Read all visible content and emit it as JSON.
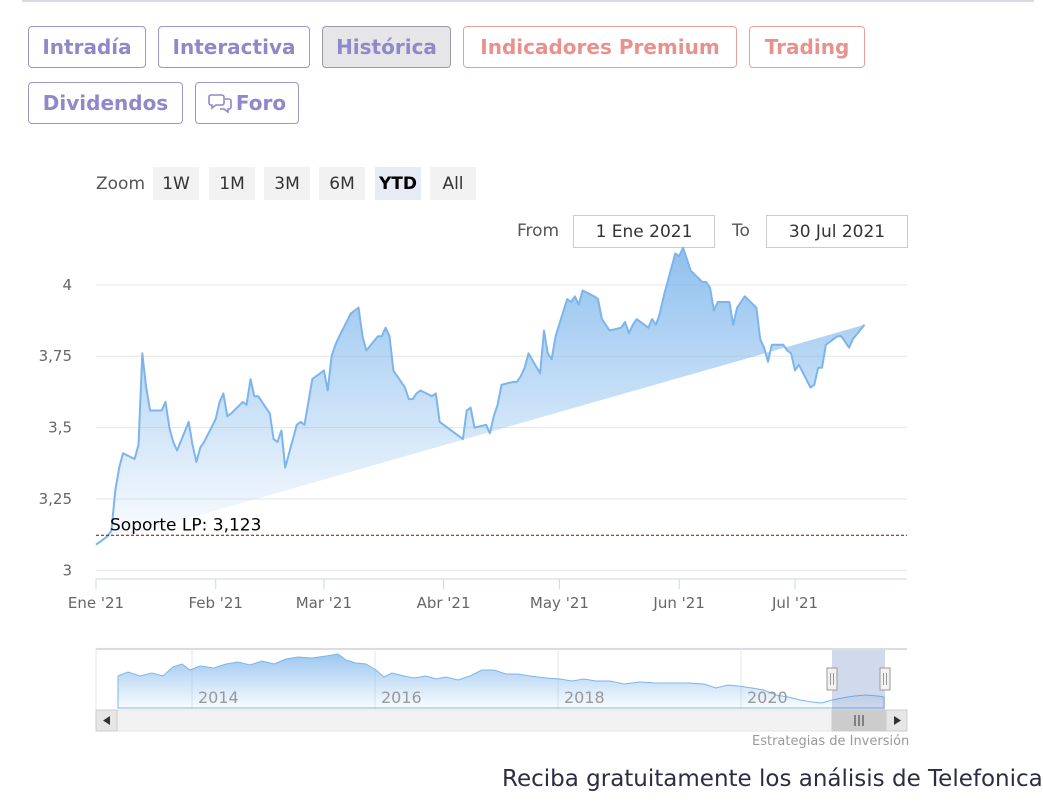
{
  "tabs": [
    {
      "label": "Intradía",
      "style": "purple"
    },
    {
      "label": "Interactiva",
      "style": "purple"
    },
    {
      "label": "Histórica",
      "style": "active"
    },
    {
      "label": "Indicadores Premium",
      "style": "red"
    },
    {
      "label": "Trading",
      "style": "red"
    },
    {
      "label": "Dividendos",
      "style": "purple"
    },
    {
      "label": "Foro",
      "style": "purple",
      "icon": "chat-bubbles-icon"
    }
  ],
  "zoom": {
    "label": "Zoom",
    "buttons": [
      "1W",
      "1M",
      "3M",
      "6M",
      "YTD",
      "All"
    ],
    "selected": "YTD"
  },
  "range": {
    "from_label": "From",
    "from_value": "1 Ene 2021",
    "to_label": "To",
    "to_value": "30 Jul 2021"
  },
  "chart_data": {
    "type": "area",
    "x_tick_labels": [
      "Ene '21",
      "Feb '21",
      "Mar '21",
      "Abr '21",
      "May '21",
      "Jun '21",
      "Jul '21"
    ],
    "y_tick_labels": [
      "3",
      "3,25",
      "3,5",
      "3,75",
      "4"
    ],
    "ylim": [
      2.97,
      4.22
    ],
    "grid": true,
    "x_start": "2021-01-01",
    "x": [
      "2021-01-01",
      "2021-01-04",
      "2021-01-05",
      "2021-01-06",
      "2021-01-07",
      "2021-01-08",
      "2021-01-11",
      "2021-01-12",
      "2021-01-13",
      "2021-01-14",
      "2021-01-15",
      "2021-01-18",
      "2021-01-19",
      "2021-01-20",
      "2021-01-21",
      "2021-01-22",
      "2021-01-25",
      "2021-01-26",
      "2021-01-27",
      "2021-01-28",
      "2021-01-29",
      "2021-02-01",
      "2021-02-02",
      "2021-02-03",
      "2021-02-04",
      "2021-02-05",
      "2021-02-08",
      "2021-02-09",
      "2021-02-10",
      "2021-02-11",
      "2021-02-12",
      "2021-02-15",
      "2021-02-16",
      "2021-02-17",
      "2021-02-18",
      "2021-02-19",
      "2021-02-22",
      "2021-02-23",
      "2021-02-24",
      "2021-02-25",
      "2021-02-26",
      "2021-03-01",
      "2021-03-02",
      "2021-03-03",
      "2021-03-04",
      "2021-03-05",
      "2021-03-08",
      "2021-03-09",
      "2021-03-10",
      "2021-03-11",
      "2021-03-12",
      "2021-03-15",
      "2021-03-16",
      "2021-03-17",
      "2021-03-18",
      "2021-03-19",
      "2021-03-22",
      "2021-03-23",
      "2021-03-24",
      "2021-03-25",
      "2021-03-26",
      "2021-03-29",
      "2021-03-30",
      "2021-03-31",
      "2021-04-01",
      "2021-04-06",
      "2021-04-07",
      "2021-04-08",
      "2021-04-09",
      "2021-04-12",
      "2021-04-13",
      "2021-04-14",
      "2021-04-15",
      "2021-04-16",
      "2021-04-19",
      "2021-04-20",
      "2021-04-21",
      "2021-04-22",
      "2021-04-23",
      "2021-04-26",
      "2021-04-27",
      "2021-04-28",
      "2021-04-29",
      "2021-04-30",
      "2021-05-03",
      "2021-05-04",
      "2021-05-05",
      "2021-05-06",
      "2021-05-07",
      "2021-05-10",
      "2021-05-11",
      "2021-05-12",
      "2021-05-13",
      "2021-05-14",
      "2021-05-17",
      "2021-05-18",
      "2021-05-19",
      "2021-05-20",
      "2021-05-21",
      "2021-05-24",
      "2021-05-25",
      "2021-05-26",
      "2021-05-27",
      "2021-05-28",
      "2021-05-31",
      "2021-06-01",
      "2021-06-02",
      "2021-06-03",
      "2021-06-04",
      "2021-06-07",
      "2021-06-08",
      "2021-06-09",
      "2021-06-10",
      "2021-06-11",
      "2021-06-14",
      "2021-06-15",
      "2021-06-16",
      "2021-06-17",
      "2021-06-18",
      "2021-06-21",
      "2021-06-22",
      "2021-06-23",
      "2021-06-24",
      "2021-06-25",
      "2021-06-28",
      "2021-06-29",
      "2021-06-30",
      "2021-07-01",
      "2021-07-02",
      "2021-07-05",
      "2021-07-06",
      "2021-07-07",
      "2021-07-08",
      "2021-07-09",
      "2021-07-12",
      "2021-07-13",
      "2021-07-14",
      "2021-07-15",
      "2021-07-16",
      "2021-07-19",
      "2021-07-20",
      "2021-07-21",
      "2021-07-22",
      "2021-07-23",
      "2021-07-26",
      "2021-07-27",
      "2021-07-28",
      "2021-07-29",
      "2021-07-30"
    ],
    "y": [
      3.09,
      3.12,
      3.14,
      3.28,
      3.36,
      3.41,
      3.39,
      3.44,
      3.76,
      3.64,
      3.56,
      3.56,
      3.59,
      3.5,
      3.45,
      3.42,
      3.52,
      3.44,
      3.38,
      3.43,
      3.45,
      3.53,
      3.59,
      3.62,
      3.54,
      3.55,
      3.59,
      3.58,
      3.67,
      3.61,
      3.61,
      3.55,
      3.46,
      3.45,
      3.49,
      3.36,
      3.51,
      3.52,
      3.51,
      3.59,
      3.67,
      3.7,
      3.63,
      3.75,
      3.79,
      3.82,
      3.9,
      3.91,
      3.92,
      3.82,
      3.77,
      3.82,
      3.82,
      3.85,
      3.82,
      3.7,
      3.64,
      3.6,
      3.6,
      3.62,
      3.63,
      3.61,
      3.62,
      3.52,
      3.51,
      3.46,
      3.56,
      3.57,
      3.5,
      3.51,
      3.48,
      3.54,
      3.58,
      3.65,
      3.66,
      3.66,
      3.68,
      3.71,
      3.76,
      3.69,
      3.84,
      3.76,
      3.74,
      3.82,
      3.95,
      3.94,
      3.96,
      3.93,
      3.98,
      3.96,
      3.95,
      3.88,
      3.86,
      3.84,
      3.85,
      3.87,
      3.83,
      3.86,
      3.88,
      3.85,
      3.88,
      3.86,
      3.9,
      3.96,
      4.11,
      4.1,
      4.13,
      4.09,
      4.05,
      4.01,
      4.01,
      3.99,
      3.91,
      3.94,
      3.94,
      3.86,
      3.92,
      3.94,
      3.96,
      3.92,
      3.81,
      3.78,
      3.73,
      3.79,
      3.79,
      3.77,
      3.76,
      3.7,
      3.72,
      3.64,
      3.65,
      3.71,
      3.71,
      3.79,
      3.82,
      3.82,
      3.8,
      3.78,
      3.81,
      3.86
    ]
  },
  "support": {
    "label": "Soporte LP: 3,123",
    "value": 3.123,
    "color": "#8b0000"
  },
  "navigator": {
    "year_labels": [
      "2014",
      "2016",
      "2018",
      "2020"
    ]
  },
  "colors": {
    "line": "#7cb5ec",
    "purple": "#8f88c9",
    "red": "#e8928d"
  },
  "credits": "Estrategias de Inversión",
  "cta_text": "Reciba gratuitamente los análisis de Telefonica"
}
